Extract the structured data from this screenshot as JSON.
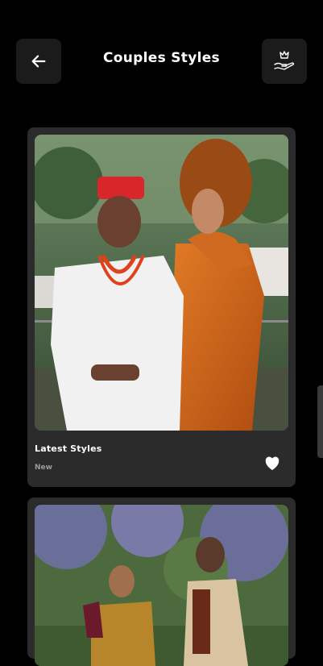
{
  "header": {
    "title": "Couples Styles",
    "back_icon": "arrow-left-icon",
    "premium_icon": "crown-hand-icon"
  },
  "cards": [
    {
      "title": "Latest Styles",
      "subtitle": "New",
      "image": "couple in red cap and white attire with woman in orange gele and gown",
      "favorite_icon": "heart-icon"
    },
    {
      "image": "couple in outdoor garden, woman in gold top, man in embroidered outfit"
    }
  ],
  "colors": {
    "background": "#000000",
    "card": "#2b2b2b",
    "button": "#1b1b1b",
    "subtitle": "#9a9a9a"
  }
}
